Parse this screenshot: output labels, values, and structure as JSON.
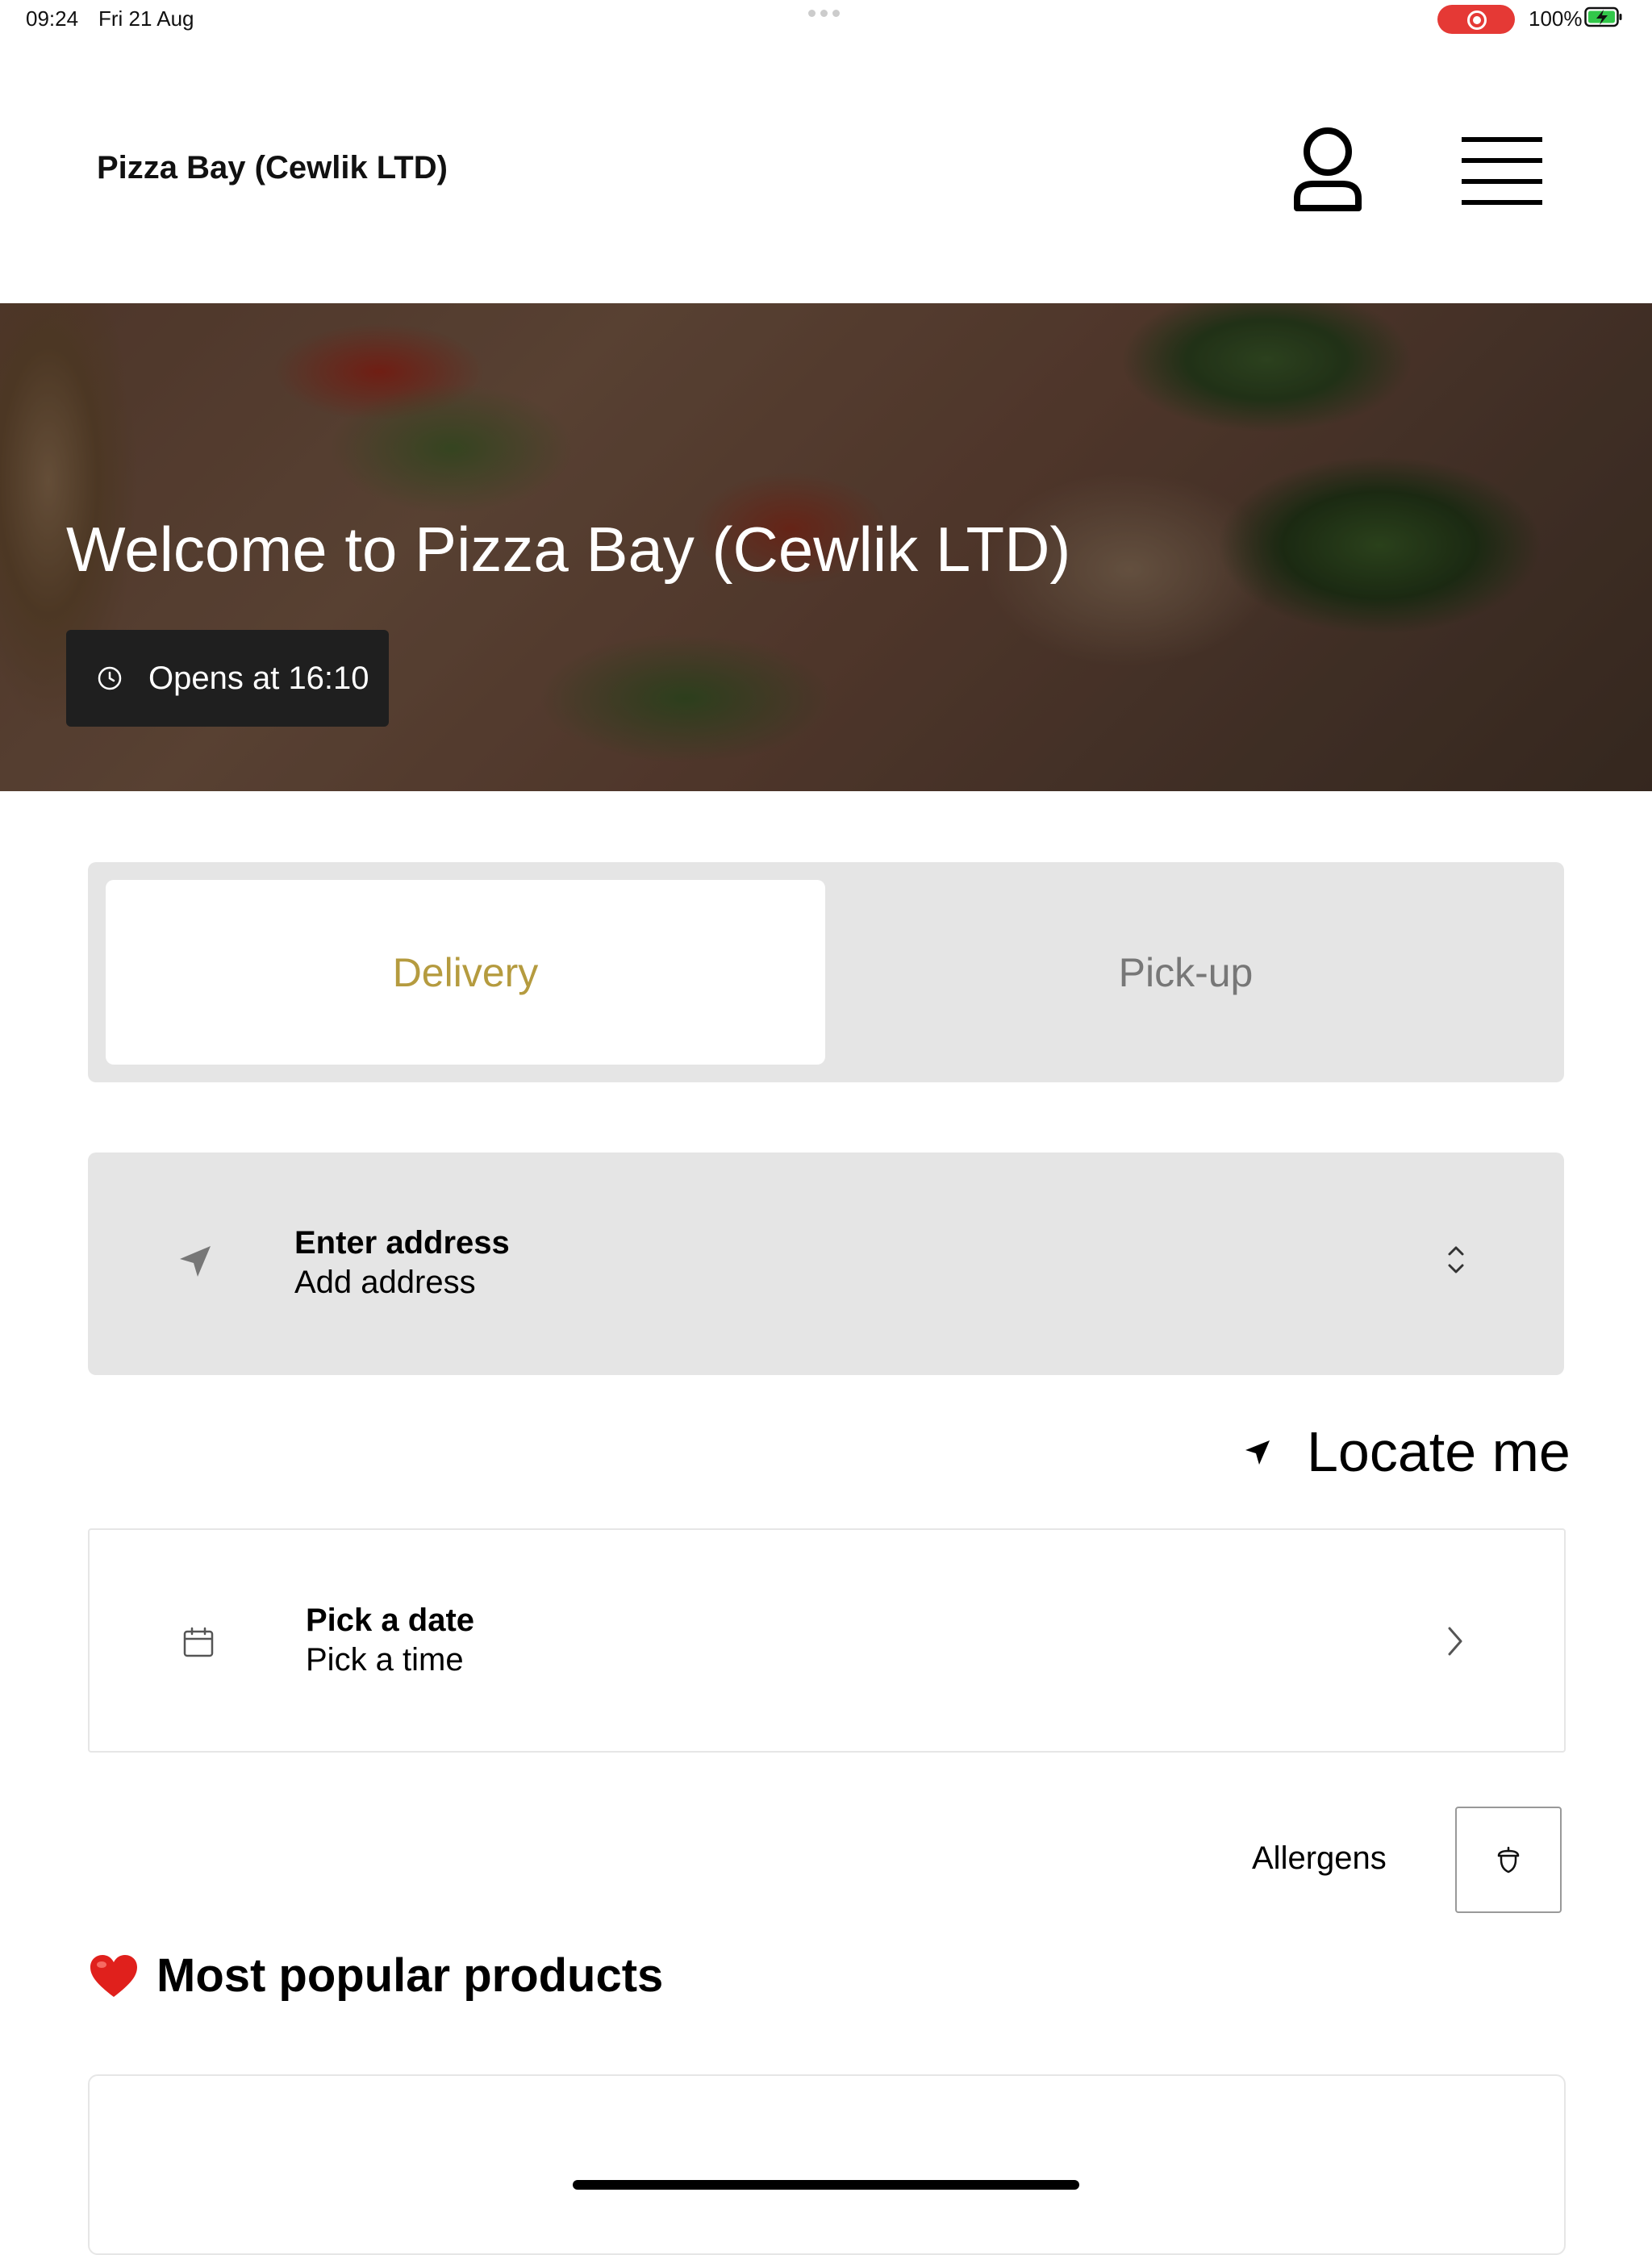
{
  "status_bar": {
    "time": "09:24",
    "date": "Fri 21 Aug",
    "battery_percent": "100%",
    "recording_color": "#e53935",
    "battery_color": "#32c74a"
  },
  "header": {
    "restaurant_name": "Pizza Bay (Cewlik LTD)",
    "account_icon": "user-icon",
    "menu_icon": "hamburger-menu-icon"
  },
  "hero": {
    "title": "Welcome to Pizza Bay (Cewlik LTD)",
    "opening_status": "Opens at 16:10",
    "status_icon": "clock-icon"
  },
  "order_type": {
    "options": [
      "Delivery",
      "Pick-up"
    ],
    "selected": "Delivery",
    "accent_color": "#b59b3f"
  },
  "address": {
    "title": "Enter address",
    "subtitle": "Add address",
    "icon": "location-arrow-icon"
  },
  "locate": {
    "label": "Locate me",
    "icon": "location-arrow-icon"
  },
  "schedule": {
    "title": "Pick a date",
    "subtitle": "Pick a time",
    "icon": "calendar-icon"
  },
  "allergens": {
    "label": "Allergens",
    "icon": "acorn-icon"
  },
  "popular": {
    "emoji": "❤️",
    "heading": "Most popular products"
  }
}
